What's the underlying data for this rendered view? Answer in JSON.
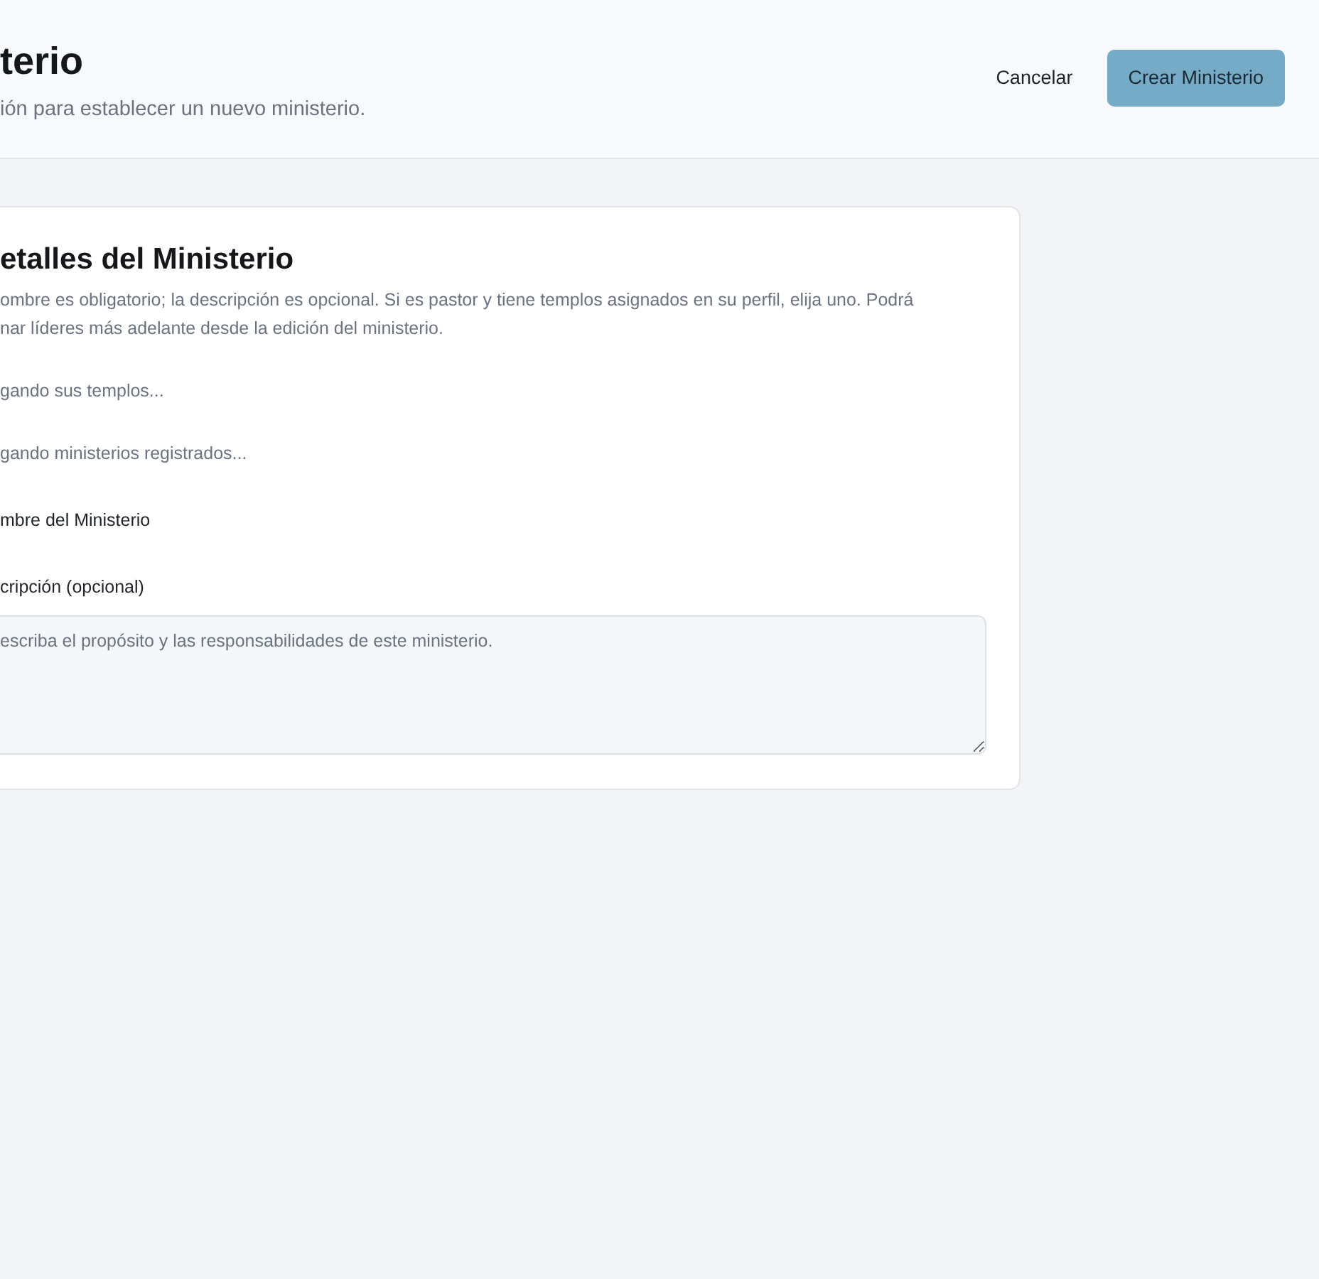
{
  "header": {
    "title": "terio",
    "subtitle": "ión para establecer un nuevo ministerio.",
    "cancel_button": "Cancelar",
    "submit_button": {
      "label": "Crear Ministerio",
      "disabled": true
    }
  },
  "card": {
    "title": "etalles del Ministerio",
    "description_lines": [
      "ombre es obligatorio; la descripción es opcional. Si es pastor y tiene templos asignados en su perfil, elija uno. Podrá",
      "nar líderes más adelante desde la edición del ministerio."
    ],
    "loading_messages": [
      "gando sus templos...",
      "gando ministerios registrados..."
    ],
    "name_label": "mbre del Ministerio",
    "description_label": "cripción (opcional)",
    "description_field": {
      "placeholder": "escriba el propósito y las responsabilidades de este ministerio."
    }
  }
}
